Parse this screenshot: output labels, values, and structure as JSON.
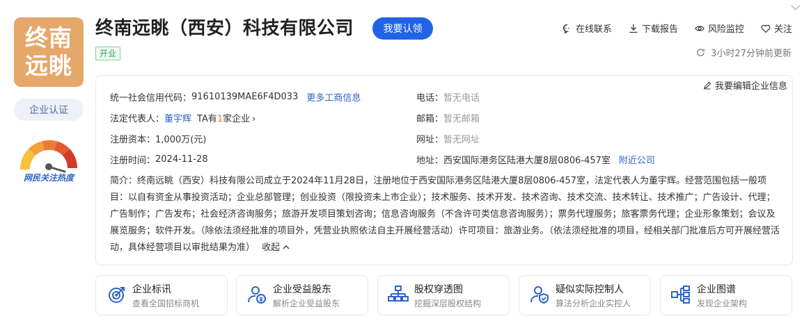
{
  "logo": {
    "text": "终南远眺",
    "bg_color": "#e6a76a"
  },
  "certification_label": "企业认证",
  "heat_label": "网民关注热度",
  "header": {
    "company_name": "终南远眺（西安）科技有限公司",
    "claim_label": "我要认领",
    "status": "开业",
    "actions": [
      {
        "label": "在线联系",
        "icon": "chat-icon"
      },
      {
        "label": "下载报告",
        "icon": "download-icon"
      },
      {
        "label": "风险监控",
        "icon": "eye-icon"
      },
      {
        "label": "关注",
        "icon": "heart-icon"
      }
    ],
    "update_time": "3小时27分钟前更新"
  },
  "info": {
    "edit_label": "我要编辑企业信息",
    "credit_code_label": "统一社会信用代码：",
    "credit_code": "91610139MAE6F4D033",
    "more_info_link": "更多工商信息",
    "legal_rep_label": "法定代表人：",
    "legal_rep": "董宇辉",
    "legal_rep_ta_prefix": "TA有",
    "legal_rep_count": "1",
    "legal_rep_ta_suffix": "家企业",
    "capital_label": "注册资本：",
    "capital": "1,000万(元)",
    "reg_date_label": "注册时间：",
    "reg_date": "2024-11-28",
    "phone_label": "电话：",
    "phone": "暂无电话",
    "email_label": "邮箱：",
    "email": "暂无邮箱",
    "website_label": "网址：",
    "website": "暂无网址",
    "address_label": "地址：",
    "address": "西安国际港务区陆港大厦8层0806-457室",
    "nearby_link": "附近公司",
    "intro_label": "简介：",
    "intro": "终南远眺（西安）科技有限公司成立于2024年11月28日，注册地位于西安国际港务区陆港大厦8层0806-457室，法定代表人为董宇辉。经营范围包括一般项目：以自有资金从事投资活动；企业总部管理；创业投资（限投资未上市企业）；技术服务、技术开发、技术咨询、技术交流、技术转让、技术推广；广告设计、代理；广告制作；广告发布；社会经济咨询服务；旅游开发项目策划咨询；信息咨询服务（不含许可类信息咨询服务）；票务代理服务；旅客票务代理；企业形象策划；会议及展览服务；软件开发。（除依法须经批准的项目外，凭营业执照依法自主开展经营活动）许可项目：旅游业务。（依法须经批准的项目，经相关部门批准后方可开展经营活动，具体经营项目以审批结果为准）",
    "collapse_label": "收起"
  },
  "features": [
    {
      "title": "企业标讯",
      "subtitle": "查看全国招标商机",
      "icon": "target-icon"
    },
    {
      "title": "企业受益股东",
      "subtitle": "解析企业受益股东",
      "icon": "shareholder-icon"
    },
    {
      "title": "股权穿透图",
      "subtitle": "挖掘深层股权结构",
      "icon": "equity-tree-icon"
    },
    {
      "title": "疑似实际控制人",
      "subtitle": "算法分析企业实控人",
      "icon": "controller-icon"
    },
    {
      "title": "企业图谱",
      "subtitle": "发现企业架构",
      "icon": "graph-icon"
    }
  ],
  "colors": {
    "brand_blue": "#2064e5",
    "link_blue": "#2d63c8",
    "status_green": "#27a552",
    "accent_orange": "#f27c1e"
  }
}
